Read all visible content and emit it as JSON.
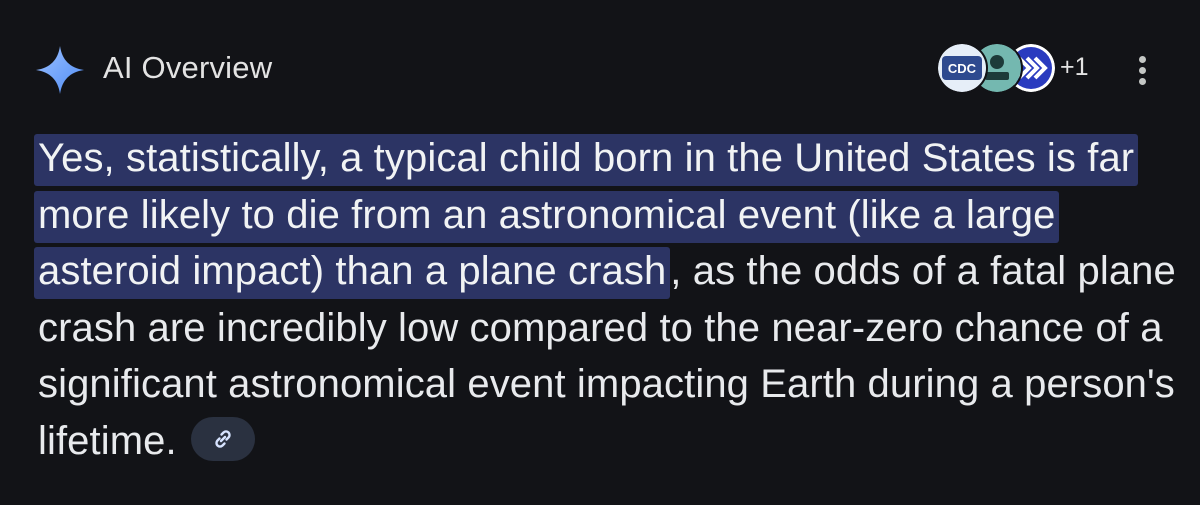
{
  "header": {
    "title": "AI Overview",
    "sparkle_icon": "sparkle-icon",
    "more_icon": "more-vert-icon"
  },
  "sources": {
    "items": [
      {
        "name": "source-cdc",
        "label": "CDC",
        "bg": "#2e4a8f"
      },
      {
        "name": "source-person",
        "label": "",
        "bg": "#74b8b0"
      },
      {
        "name": "source-arrows",
        "label": "",
        "bg": "#2a3bbf"
      }
    ],
    "more_count": "+1"
  },
  "overview": {
    "highlighted_text": "Yes, statistically, a typical child born in the United States is far more likely to die from an astronomical event (like a large asteroid impact) than a plane crash",
    "rest_text": ", as the odds of a fatal plane crash are incredibly low compared to the near-zero chance of a significant astronomical event impacting Earth during a person's lifetime.",
    "link_icon": "link-icon"
  },
  "colors": {
    "background": "#121317",
    "highlight": "#2c3464",
    "accent": "#8ab4f8",
    "chip": "#2a3140"
  }
}
